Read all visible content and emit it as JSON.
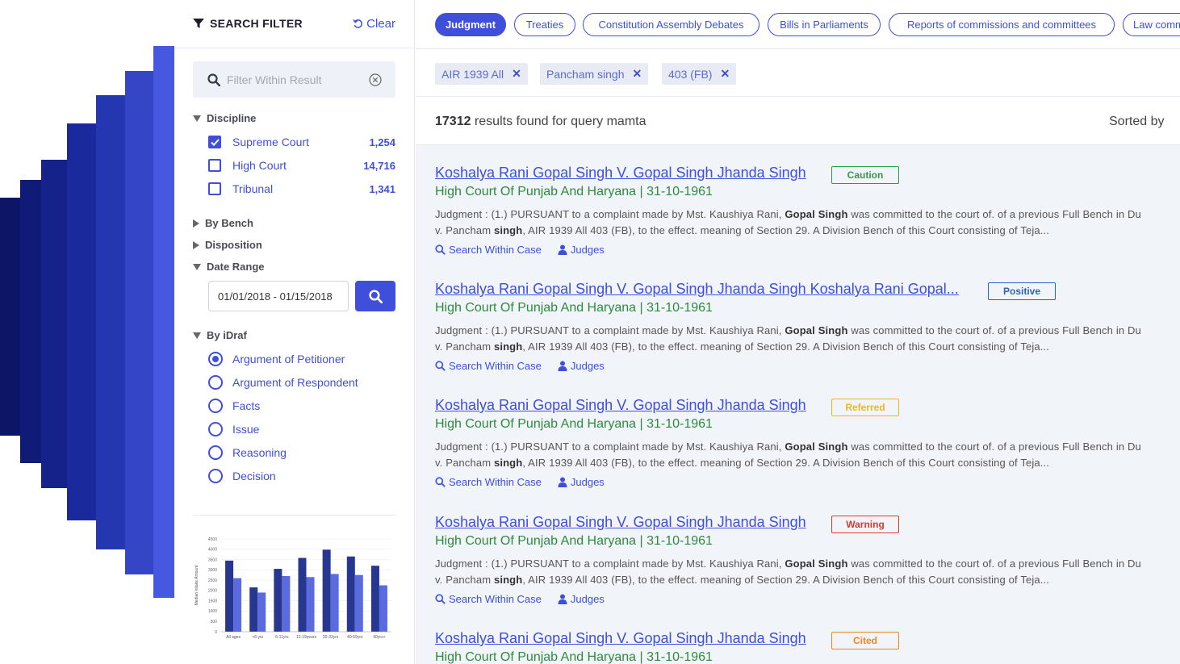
{
  "sidebar": {
    "title": "SEARCH FILTER",
    "clear_label": "Clear",
    "filter_placeholder": "Filter Within Result",
    "discipline": {
      "heading": "Discipline",
      "items": [
        {
          "label": "Supreme Court",
          "count": "1,254",
          "checked": true
        },
        {
          "label": "High Court",
          "count": "14,716",
          "checked": false
        },
        {
          "label": "Tribunal",
          "count": "1,341",
          "checked": false
        }
      ]
    },
    "by_bench": "By Bench",
    "disposition": "Disposition",
    "date_range": {
      "heading": "Date Range",
      "value": "01/01/2018 - 01/15/2018"
    },
    "by_idraf": {
      "heading": "By iDraf",
      "options": [
        {
          "label": "Argument of Petitioner",
          "selected": true
        },
        {
          "label": "Argument of Respondent",
          "selected": false
        },
        {
          "label": "Facts",
          "selected": false
        },
        {
          "label": "Issue",
          "selected": false
        },
        {
          "label": "Reasoning",
          "selected": false
        },
        {
          "label": "Decision",
          "selected": false
        }
      ]
    }
  },
  "chart_data": {
    "type": "bar",
    "categories": [
      "All ages",
      "<6 yrs",
      "6-11yrs",
      "12-19years",
      "20-33yrs",
      "40-59yrs",
      "60yrs+"
    ],
    "series": [
      {
        "values": [
          3450,
          2150,
          3050,
          3580,
          3980,
          3650,
          3200
        ],
        "color": "#27378f"
      },
      {
        "values": [
          2600,
          1900,
          2700,
          2650,
          2800,
          2750,
          2250
        ],
        "color": "#5a6be0"
      }
    ],
    "ylabel": "Median Intake Amount",
    "ylim": [
      0,
      4500
    ],
    "yticks": [
      "0",
      "500",
      "1000",
      "1500",
      "2000",
      "2500",
      "3000",
      "3500",
      "4000",
      "4500"
    ]
  },
  "tabs": [
    {
      "label": "Judgment",
      "active": true
    },
    {
      "label": "Treaties",
      "active": false
    },
    {
      "label": "Constitution Assembly Debates",
      "active": false
    },
    {
      "label": "Bills in Parliaments",
      "active": false
    },
    {
      "label": "Reports of commissions and committees",
      "active": false
    },
    {
      "label": "Law comm",
      "active": false
    }
  ],
  "chips": [
    {
      "label": "AIR 1939 All"
    },
    {
      "label": "Pancham singh"
    },
    {
      "label": "403 (FB)"
    }
  ],
  "results_summary": {
    "count": "17312",
    "text": "results found for query mamta",
    "sorted_label": "Sorted by"
  },
  "results": [
    {
      "title": "Koshalya Rani Gopal Singh V. Gopal Singh Jhanda Singh",
      "badge": "Caution",
      "badge_color": "#2f9a46",
      "court": "High Court Of Punjab And Haryana | 31-10-1961"
    },
    {
      "title": "Koshalya Rani Gopal Singh V. Gopal Singh Jhanda Singh Koshalya Rani Gopal...",
      "badge": "Positive",
      "badge_color": "#2a63b8",
      "court": "High Court Of Punjab And Haryana | 31-10-1961"
    },
    {
      "title": "Koshalya Rani Gopal Singh V. Gopal Singh Jhanda Singh",
      "badge": "Referred",
      "badge_color": "#e8b922",
      "court": "High Court Of Punjab And Haryana | 31-10-1961"
    },
    {
      "title": "Koshalya Rani Gopal Singh V. Gopal Singh Jhanda Singh",
      "badge": "Warning",
      "badge_color": "#d93b2f",
      "court": "High Court Of Punjab And Haryana | 31-10-1961"
    },
    {
      "title": "Koshalya Rani Gopal Singh V. Gopal Singh Jhanda Singh",
      "badge": "Cited",
      "badge_color": "#e8861f",
      "court": "High Court Of Punjab And Haryana | 31-10-1961"
    }
  ],
  "snippet": {
    "p1": "Judgment : (1.) PURSUANT to a complaint made by Mst. Kaushiya Rani, ",
    "b1": "Gopal Singh",
    "p2": " was committed to the court of. of a previous Full Bench in Du",
    "p3": "v. Pancham ",
    "b2": "singh",
    "p4": ", AIR 1939 All 403 (FB), to the effect. meaning of Section 29. A Division Bench of this Court consisting of Teja..."
  },
  "links": {
    "search_within": "Search Within Case",
    "judges": "Judges"
  },
  "colors": {
    "accent": "#3f4fd9",
    "court_green": "#2f8a3d",
    "results_bg": "#f1f4f9"
  }
}
